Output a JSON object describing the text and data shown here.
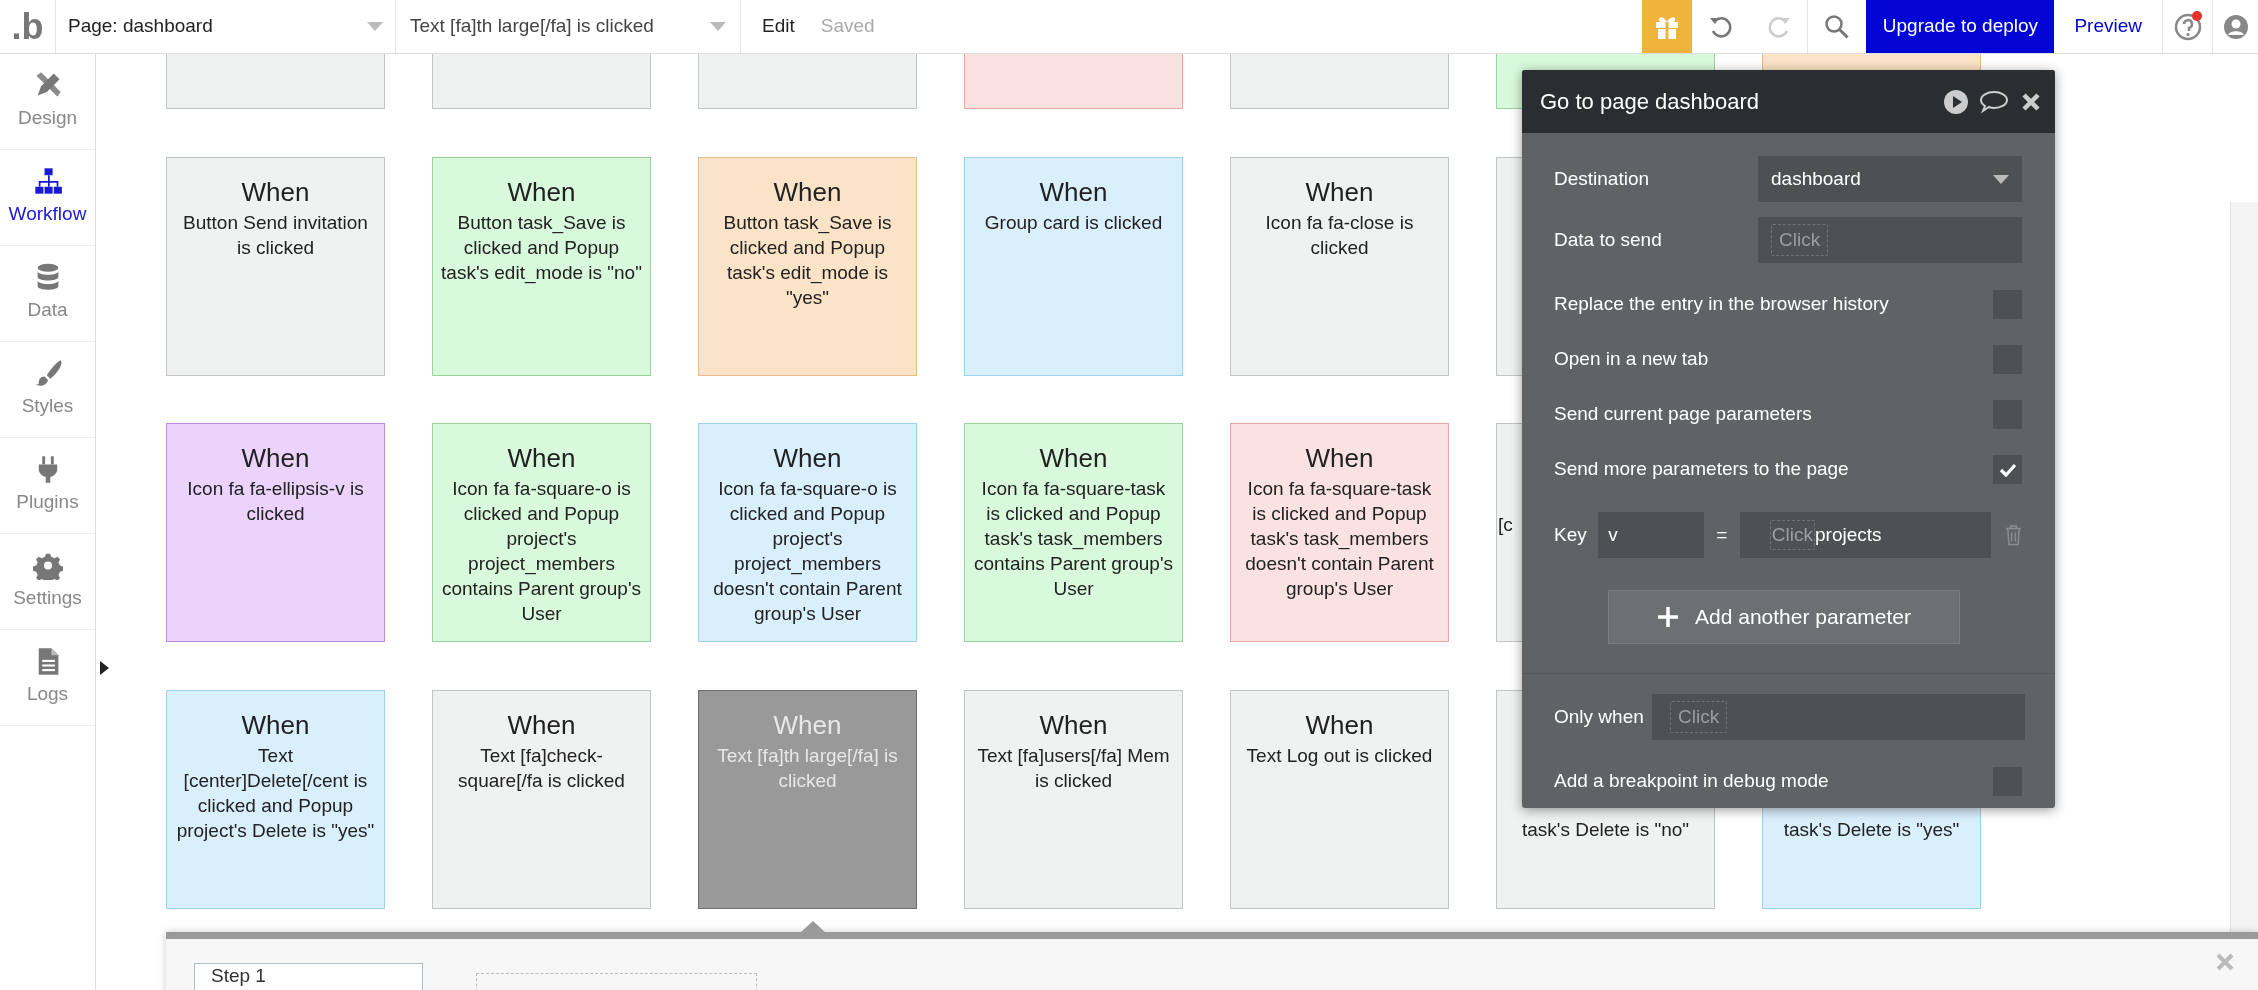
{
  "top_bar": {
    "logo": ".b",
    "page_selector": "Page: dashboard",
    "event_selector": "Text [fa]th large[/fa] is clicked",
    "edit": "Edit",
    "saved": "Saved",
    "upgrade_button": "Upgrade to deploy",
    "preview": "Preview"
  },
  "sidebar": {
    "items": [
      {
        "label": "Design",
        "selected": false
      },
      {
        "label": "Workflow",
        "selected": true
      },
      {
        "label": "Data",
        "selected": false
      },
      {
        "label": "Styles",
        "selected": false
      },
      {
        "label": "Plugins",
        "selected": false
      },
      {
        "label": "Settings",
        "selected": false
      },
      {
        "label": "Logs",
        "selected": false
      }
    ]
  },
  "event_rows": [
    {
      "cards": [
        {
          "color": "#f0f1f1",
          "selected": false
        },
        {
          "color": "#f0f1f1",
          "selected": false
        },
        {
          "color": "#f0f1f1",
          "selected": false
        },
        {
          "color": "#fbe2e2",
          "selected": false
        },
        {
          "color": "#f0f1f1",
          "selected": false
        },
        {
          "color": "#d9f9dc",
          "selected": false
        },
        {
          "color": "#fbe3c7",
          "selected": false
        }
      ]
    },
    {
      "cards": [
        {
          "color": "#f0f1f1",
          "selected": false,
          "title": "When",
          "text": "Button Send invitation is clicked"
        },
        {
          "color": "#d9f9dc",
          "selected": false,
          "title": "When",
          "text": "Button task_Save is clicked and Popup task's edit_mode is \"no\""
        },
        {
          "color": "#fbe3c7",
          "selected": false,
          "title": "When",
          "text": "Button task_Save is clicked and Popup task's edit_mode is \"yes\""
        },
        {
          "color": "#d9effc",
          "selected": false,
          "title": "When",
          "text": "Group card is clicked"
        },
        {
          "color": "#f0f1f1",
          "selected": false,
          "title": "When",
          "text": "Icon fa fa-close is clicked"
        },
        {
          "color": "#f0f1f1",
          "selected": false
        }
      ]
    },
    {
      "cards": [
        {
          "color": "#ecd3fb",
          "selected": false,
          "title": "When",
          "text": "Icon fa fa-ellipsis-v is clicked"
        },
        {
          "color": "#d9f9dc",
          "selected": false,
          "title": "When",
          "text": "Icon fa fa-square-o is clicked and Popup project's project_members contains Parent group's User"
        },
        {
          "color": "#d9effc",
          "selected": false,
          "title": "When",
          "text": "Icon fa fa-square-o is clicked and Popup project's project_members doesn't contain Parent group's User"
        },
        {
          "color": "#d9f9dc",
          "selected": false,
          "title": "When",
          "text": "Icon fa fa-square-task is clicked and Popup task's task_members contains Parent group's User"
        },
        {
          "color": "#fbe2e2",
          "selected": false,
          "title": "When",
          "text": "Icon fa fa-square-task is clicked and Popup task's task_members doesn't contain Parent group's User"
        },
        {
          "color": "#f0f1f1",
          "selected": false,
          "kind": "edge",
          "text": "[c"
        }
      ]
    },
    {
      "cards": [
        {
          "color": "#d9effc",
          "selected": false,
          "title": "When",
          "text": "Text [center]Delete[/cent is clicked and Popup project's Delete is \"yes\""
        },
        {
          "color": "#f0f1f1",
          "selected": false,
          "title": "When",
          "text": "Text [fa]check-square[/fa is clicked"
        },
        {
          "selected": true,
          "title": "When",
          "text": "Text [fa]th large[/fa] is clicked"
        },
        {
          "color": "#f0f1f1",
          "selected": false,
          "title": "When",
          "text": "Text [fa]users[/fa] Mem is clicked"
        },
        {
          "color": "#f0f1f1",
          "selected": false,
          "title": "When",
          "text": "Text Log out is clicked"
        },
        {
          "color": "#f0f1f1",
          "selected": false,
          "kind": "cut",
          "text": "task's Delete is \"no\""
        },
        {
          "color": "#d9effc",
          "selected": false,
          "kind": "cut",
          "text": "task's Delete is \"yes\""
        }
      ]
    }
  ],
  "action_panel": {
    "title": "Go to page dashboard",
    "destination": {
      "label": "Destination",
      "value": "dashboard"
    },
    "data_to_send": {
      "label": "Data to send",
      "placeholder": "Click"
    },
    "options": [
      {
        "label": "Replace the entry in the browser history",
        "checked": false
      },
      {
        "label": "Open in a new tab",
        "checked": false
      },
      {
        "label": "Send current page parameters",
        "checked": false
      },
      {
        "label": "Send more parameters to the page",
        "checked": true
      }
    ],
    "parameter": {
      "label": "Key",
      "key": "v",
      "equals": "=",
      "placeholder": "Click",
      "value": "projects"
    },
    "add_button": "Add another parameter",
    "only_when": {
      "label": "Only when",
      "placeholder": "Click"
    },
    "breakpoint": {
      "label": "Add a breakpoint in debug mode",
      "checked": false
    }
  },
  "steps_panel": {
    "step": "Step 1"
  }
}
